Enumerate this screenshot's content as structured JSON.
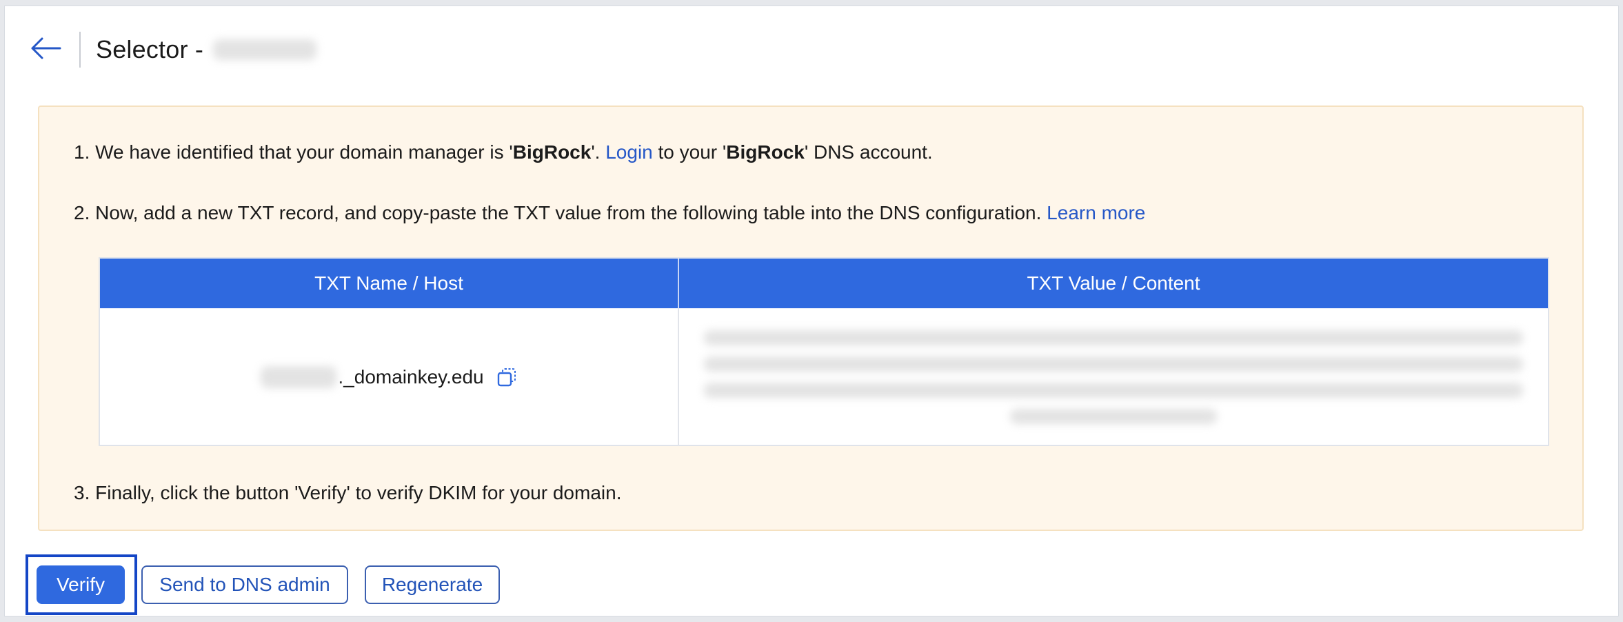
{
  "header": {
    "title": "Selector -",
    "back_icon": "arrow-left-icon"
  },
  "instructions": {
    "step1": {
      "prefix": "1. We have identified that your domain manager is '",
      "manager": "BigRock",
      "mid": "'. ",
      "login_link": "Login",
      "mid2": " to your '",
      "manager2": "BigRock",
      "suffix": "' DNS account."
    },
    "step2": {
      "text": "2. Now, add a new TXT record, and copy-paste the TXT value from the following table into the DNS configuration.",
      "learn_more": "Learn more"
    },
    "step3": {
      "text": "3. Finally, click the button 'Verify' to verify DKIM for your domain."
    }
  },
  "table": {
    "headers": [
      "TXT Name / Host",
      "TXT Value / Content"
    ],
    "row": {
      "host_suffix": "._domainkey.edu",
      "copy_icon": "copy-icon"
    }
  },
  "actions": {
    "verify": "Verify",
    "send_to_dns_admin": "Send to DNS admin",
    "regenerate": "Regenerate"
  },
  "colors": {
    "primary": "#2f69df",
    "link": "#2557c7",
    "panel_bg": "#fef6ea",
    "focus_ring": "#1446c6"
  }
}
